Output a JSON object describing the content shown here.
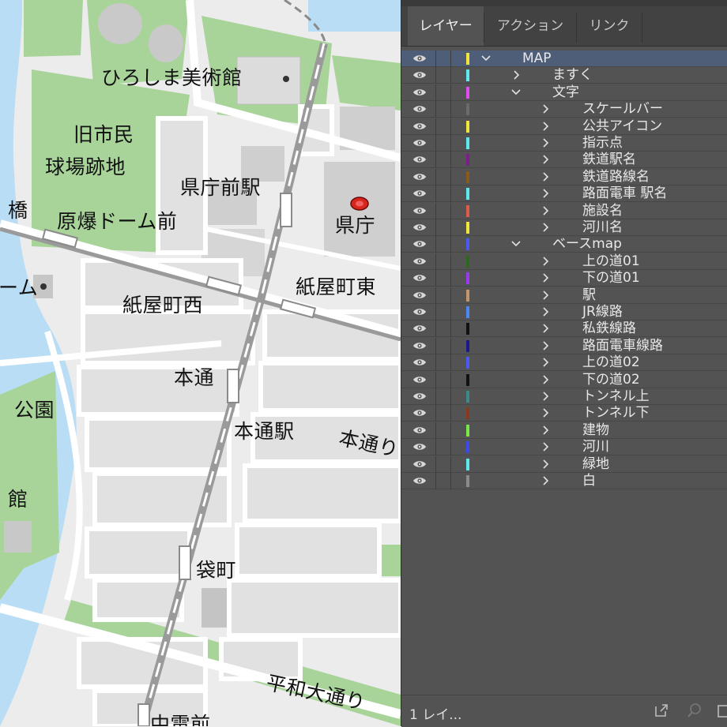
{
  "map": {
    "labels": [
      {
        "id": "hiroshima-museum",
        "text": "ひろしま美術館"
      },
      {
        "id": "old-stadium-1",
        "text": "旧市民"
      },
      {
        "id": "old-stadium-2",
        "text": "球場跡地"
      },
      {
        "id": "kencho-mae-station",
        "text": "県庁前駅"
      },
      {
        "id": "kencho",
        "text": "県庁"
      },
      {
        "id": "bridge",
        "text": "橋"
      },
      {
        "id": "genbaku-dome-mae",
        "text": "原爆ドーム前"
      },
      {
        "id": "dome",
        "text": "ーム"
      },
      {
        "id": "kamiyacho-nishi",
        "text": "紙屋町西"
      },
      {
        "id": "kamiyacho-higashi",
        "text": "紙屋町東"
      },
      {
        "id": "hondori",
        "text": "本通"
      },
      {
        "id": "park",
        "text": "公園"
      },
      {
        "id": "hondori-station",
        "text": "本通駅"
      },
      {
        "id": "hondori-partial",
        "text": "本通り"
      },
      {
        "id": "kan",
        "text": "館"
      },
      {
        "id": "fukuromachi",
        "text": "袋町"
      },
      {
        "id": "heiwa-odori",
        "text": "平和大通り"
      },
      {
        "id": "chuden-mae",
        "text": "中電前"
      }
    ],
    "colors": {
      "water": "#b9ddf4",
      "green": "#a8d49a",
      "road": "#ffffff",
      "block": "#e3e3e3",
      "building": "#c6c6c6",
      "rail": "#9a9a9a",
      "kencho_icon": "#d9261c"
    }
  },
  "panel": {
    "tabs": [
      {
        "label": "レイヤー",
        "active": true
      },
      {
        "label": "アクション",
        "active": false
      },
      {
        "label": "リンク",
        "active": false
      }
    ],
    "layers": [
      {
        "name": "MAP",
        "depth": 0,
        "expanded": true,
        "color": "#f2e43a",
        "selected": true
      },
      {
        "name": "ますく",
        "depth": 1,
        "expanded": false,
        "color": "#5ee8f0"
      },
      {
        "name": "文字",
        "depth": 1,
        "expanded": true,
        "color": "#e04df0"
      },
      {
        "name": "スケールバー",
        "depth": 2,
        "expanded": false,
        "color": "#6a6a6a"
      },
      {
        "name": "公共アイコン",
        "depth": 2,
        "expanded": false,
        "color": "#f2e43a"
      },
      {
        "name": "指示点",
        "depth": 2,
        "expanded": false,
        "color": "#5ee8f0"
      },
      {
        "name": "鉄道駅名",
        "depth": 2,
        "expanded": false,
        "color": "#7a1f8a"
      },
      {
        "name": "鉄道路線名",
        "depth": 2,
        "expanded": false,
        "color": "#8a5a1a"
      },
      {
        "name": "路面電車 駅名",
        "depth": 2,
        "expanded": false,
        "color": "#5ee8f0"
      },
      {
        "name": "施設名",
        "depth": 2,
        "expanded": false,
        "color": "#e05a4a"
      },
      {
        "name": "河川名",
        "depth": 2,
        "expanded": false,
        "color": "#f2e43a"
      },
      {
        "name": "ベースmap",
        "depth": 1,
        "expanded": true,
        "color": "#4a5af0"
      },
      {
        "name": "上の道01",
        "depth": 2,
        "expanded": false,
        "color": "#2a6a1a"
      },
      {
        "name": "下の道01",
        "depth": 2,
        "expanded": false,
        "color": "#9a3af0"
      },
      {
        "name": "駅",
        "depth": 2,
        "expanded": false,
        "color": "#c8946a"
      },
      {
        "name": "JR線路",
        "depth": 2,
        "expanded": false,
        "color": "#4a8af0"
      },
      {
        "name": "私鉄線路",
        "depth": 2,
        "expanded": false,
        "color": "#111111"
      },
      {
        "name": "路面電車線路",
        "depth": 2,
        "expanded": false,
        "color": "#1a1a8a"
      },
      {
        "name": "上の道02",
        "depth": 2,
        "expanded": false,
        "color": "#4a5af0"
      },
      {
        "name": "下の道02",
        "depth": 2,
        "expanded": false,
        "color": "#111111"
      },
      {
        "name": "トンネル上",
        "depth": 2,
        "expanded": false,
        "color": "#3a8a8a"
      },
      {
        "name": "トンネル下",
        "depth": 2,
        "expanded": false,
        "color": "#8a3a1a"
      },
      {
        "name": "建物",
        "depth": 2,
        "expanded": false,
        "color": "#7ae84a"
      },
      {
        "name": "河川",
        "depth": 2,
        "expanded": false,
        "color": "#3a4af0"
      },
      {
        "name": "緑地",
        "depth": 2,
        "expanded": false,
        "color": "#5ee8f0"
      },
      {
        "name": "白",
        "depth": 2,
        "expanded": false,
        "color": "#8a8a8a"
      }
    ],
    "footer": {
      "text": "1 レイ...",
      "icons": [
        "export-icon",
        "search-icon",
        "new-layer-icon"
      ]
    }
  }
}
